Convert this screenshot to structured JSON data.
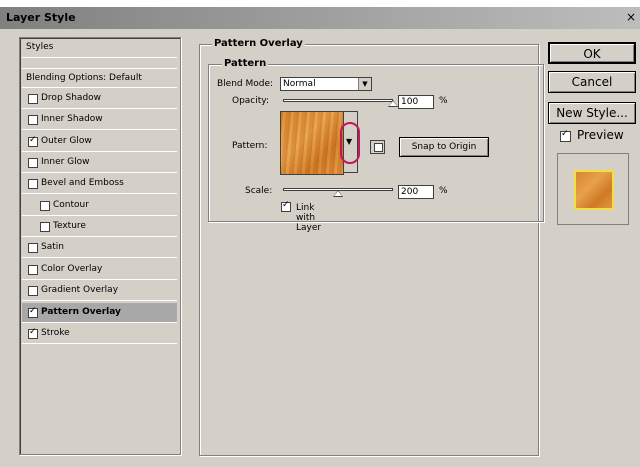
{
  "window": {
    "title": "Layer Style",
    "close_glyph": "×"
  },
  "styles_panel": {
    "header": "Styles",
    "blending": "Blending Options: Default",
    "items": [
      {
        "label": "Drop Shadow",
        "checked": false,
        "indent": 0
      },
      {
        "label": "Inner Shadow",
        "checked": false,
        "indent": 0
      },
      {
        "label": "Outer Glow",
        "checked": true,
        "indent": 0
      },
      {
        "label": "Inner Glow",
        "checked": false,
        "indent": 0
      },
      {
        "label": "Bevel and Emboss",
        "checked": false,
        "indent": 0
      },
      {
        "label": "Contour",
        "checked": false,
        "indent": 1
      },
      {
        "label": "Texture",
        "checked": false,
        "indent": 1
      },
      {
        "label": "Satin",
        "checked": false,
        "indent": 0
      },
      {
        "label": "Color Overlay",
        "checked": false,
        "indent": 0
      },
      {
        "label": "Gradient Overlay",
        "checked": false,
        "indent": 0
      },
      {
        "label": "Pattern Overlay",
        "checked": true,
        "indent": 0,
        "selected": true
      },
      {
        "label": "Stroke",
        "checked": true,
        "indent": 0
      }
    ]
  },
  "pattern_overlay": {
    "group_title": "Pattern Overlay",
    "subgroup_title": "Pattern",
    "blend_mode_label": "Blend Mode:",
    "blend_mode_value": "Normal",
    "opacity_label": "Opacity:",
    "opacity_value": "100",
    "opacity_fraction": 1.0,
    "pattern_label": "Pattern:",
    "snap_button": "Snap to Origin",
    "scale_label": "Scale:",
    "scale_value": "200",
    "scale_fraction": 0.5,
    "percent": "%",
    "link_label": "Link with Layer",
    "link_checked": true
  },
  "buttons": {
    "ok": "OK",
    "cancel": "Cancel",
    "new_style": "New Style..."
  },
  "preview": {
    "label": "Preview",
    "checked": true
  },
  "icons": {
    "dropdown": "chevron-down-icon",
    "checkmark": "check-icon",
    "new_preset": "new-preset-icon",
    "close": "close-icon"
  },
  "colors": {
    "dialog_bg": "#d4d0c8",
    "highlight_ring": "#c0185a",
    "pattern_orange": "#d8862e"
  }
}
